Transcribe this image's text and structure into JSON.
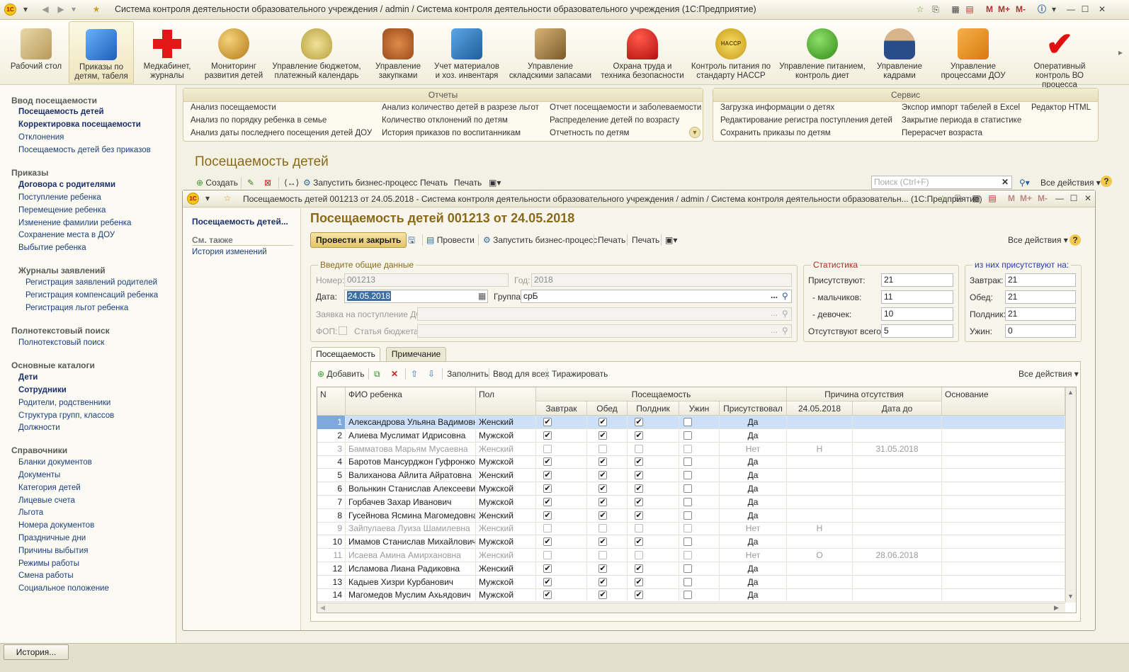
{
  "window": {
    "title": "Система контроля деятельности образовательного учреждения / admin / Система контроля деятельности образовательного учреждения  (1С:Предприятие)",
    "tb_right": [
      "M",
      "M+",
      "M-"
    ]
  },
  "sections": [
    {
      "label": "Рабочий стол"
    },
    {
      "label": "Приказы по детям, табеля"
    },
    {
      "label": "Медкабинет, журналы"
    },
    {
      "label": "Мониторинг развития детей"
    },
    {
      "label": "Управление бюджетом, платежный календарь"
    },
    {
      "label": "Управление закупками"
    },
    {
      "label": "Учет материалов и хоз. инвентаря"
    },
    {
      "label": "Управление складскими запасами"
    },
    {
      "label": "Охрана труда и техника безопасности"
    },
    {
      "label": "Контроль питания по стандарту HACCP"
    },
    {
      "label": "Управление питанием, контроль диет"
    },
    {
      "label": "Управление кадрами"
    },
    {
      "label": "Управление процессами ДОУ"
    },
    {
      "label": "Оперативный контроль ВО процесса"
    }
  ],
  "haccp_badge": "HACCP",
  "leftnav": {
    "g1": "Ввод посещаемости",
    "g1_items": [
      "Посещаемость детей",
      "Корректировка посещаемости",
      "Отклонения",
      "Посещаемость детей без приказов"
    ],
    "g2": "Приказы",
    "g2_items": [
      "Договора с родителями",
      "Поступление ребенка",
      "Перемещение ребенка",
      "Изменение фамилии ребенка",
      "Сохранение места в ДОУ",
      "Выбытие ребенка"
    ],
    "g3": "Журналы заявлений",
    "g3_items": [
      "Регистрация заявлений родителей",
      "Регистрация компенсаций ребенка",
      "Регистрация льгот ребенка"
    ],
    "g4": "Полнотекстовый поиск",
    "g4_items": [
      "Полнотекстовый поиск"
    ],
    "g5": "Основные каталоги",
    "g5_items": [
      "Дети",
      "Сотрудники",
      "Родители, родственники",
      "Структура групп, классов",
      "Должности"
    ],
    "g6": "Справочники",
    "g6_items": [
      "Бланки документов",
      "Документы",
      "Категория детей",
      "Лицевые счета",
      "Льгота",
      "Номера документов",
      "Праздничные дни",
      "Причины выбытия",
      "Режимы работы",
      "Смена работы",
      "Социальное положение"
    ]
  },
  "reports": {
    "title": "Отчеты",
    "col1": [
      "Анализ посещаемости",
      "Анализ по порядку ребенка в семье",
      "Анализ даты последнего посещения детей ДОУ"
    ],
    "col2": [
      "Анализ количество детей в разрезе льгот",
      "Количество отклонений по детям",
      "История приказов по воспитанникам"
    ],
    "col3": [
      "Отчет посещаемости и заболеваемости",
      "Распределение детей по возрасту",
      "Отчетность по детям"
    ]
  },
  "service": {
    "title": "Сервис",
    "col1": [
      "Загрузка информации о детях",
      "Редактирование регистра поступления детей",
      "Сохранить приказы по детям"
    ],
    "col2": [
      "Экспор импорт табелей в Excel",
      "Закрытие периода в статистике",
      "Перерасчет возраста"
    ],
    "col3": [
      "Редактор HTML"
    ]
  },
  "list_page": {
    "title": "Посещаемость детей",
    "create": "Создать",
    "run_bp": "Запустить бизнес-процесс",
    "print1": "Печать",
    "print2": "Печать",
    "search_placeholder": "Поиск (Ctrl+F)",
    "all_actions": "Все действия"
  },
  "doc": {
    "window_title": "Посещаемость детей 001213 от 24.05.2018 - Система контроля деятельности образовательного учреждения / admin / Система контроля деятельности образовательн... (1С:Предприятие)",
    "nav_current": "Посещаемость детей...",
    "see_also": "См. также",
    "history": "История изменений",
    "heading": "Посещаемость детей 001213 от 24.05.2018",
    "post_close": "Провести и закрыть",
    "post": "Провести",
    "run_bp": "Запустить бизнес-процесс",
    "print1": "Печать",
    "print2": "Печать",
    "all_actions": "Все действия",
    "general_group": "Введите общие данные",
    "number_label": "Номер:",
    "number": "001213",
    "year_label": "Год:",
    "year": "2018",
    "date_label": "Дата:",
    "date": "24.05.2018",
    "group_label": "Группа:",
    "group": "срБ",
    "request_label": "Заявка на поступление ДС:",
    "fop_label": "ФОП:",
    "budget_label": "Статья бюджета:",
    "stats_group": "Статистика",
    "present_label": "Присутствуют:",
    "present": "21",
    "boys_label": "- мальчиков:",
    "boys": "11",
    "girls_label": "- девочек:",
    "girls": "10",
    "absent_label": "Отсутствуют всего:",
    "absent": "5",
    "meals_group": "из них присутствуют на:",
    "breakfast_label": "Завтрак:",
    "breakfast": "21",
    "lunch_label": "Обед:",
    "lunch": "21",
    "snack_label": "Полдник:",
    "snack": "21",
    "dinner_label": "Ужин:",
    "dinner": "0",
    "tab1": "Посещаемость",
    "tab2": "Примечание",
    "add": "Добавить",
    "fill": "Заполнить",
    "input_all": "Ввод для всех",
    "replicate": "Тиражировать",
    "grid_all_actions": "Все действия"
  },
  "grid": {
    "h_n": "N",
    "h_fio": "ФИО ребенка",
    "h_sex": "Пол",
    "h_att": "Посещаемость",
    "h_breakfast": "Завтрак",
    "h_lunch": "Обед",
    "h_snack": "Полдник",
    "h_dinner": "Ужин",
    "h_present": "Присутствовал",
    "h_reason": "Причина отсутствия",
    "h_date": "24.05.2018",
    "h_date_to": "Дата до",
    "h_basis": "Основание",
    "rows": [
      {
        "n": "1",
        "fio": "Александрова Ульяна Вадимовна",
        "sex": "Женский",
        "b": true,
        "l": true,
        "s": true,
        "d": false,
        "p": "Да",
        "r": "",
        "to": ""
      },
      {
        "n": "2",
        "fio": "Алиева Муслимат Идрисовна",
        "sex": "Мужской",
        "b": true,
        "l": true,
        "s": true,
        "d": false,
        "p": "Да",
        "r": "",
        "to": ""
      },
      {
        "n": "3",
        "fio": "Бамматова Марьям Мусаевна",
        "sex": "Женский",
        "b": false,
        "l": false,
        "s": false,
        "d": false,
        "p": "Нет",
        "r": "Н",
        "to": "31.05.2018"
      },
      {
        "n": "4",
        "fio": "Баротов Мансурджон Гуфронжон...",
        "sex": "Мужской",
        "b": true,
        "l": true,
        "s": true,
        "d": false,
        "p": "Да",
        "r": "",
        "to": ""
      },
      {
        "n": "5",
        "fio": "Валиханова Айлита Айратовна",
        "sex": "Женский",
        "b": true,
        "l": true,
        "s": true,
        "d": false,
        "p": "Да",
        "r": "",
        "to": ""
      },
      {
        "n": "6",
        "fio": "Вольнкин Станислав Алексеевич",
        "sex": "Мужской",
        "b": true,
        "l": true,
        "s": true,
        "d": false,
        "p": "Да",
        "r": "",
        "to": ""
      },
      {
        "n": "7",
        "fio": "Горбачев Захар Иванович",
        "sex": "Мужской",
        "b": true,
        "l": true,
        "s": true,
        "d": false,
        "p": "Да",
        "r": "",
        "to": ""
      },
      {
        "n": "8",
        "fio": "Гусейнова Ясмина Магомедовна",
        "sex": "Женский",
        "b": true,
        "l": true,
        "s": true,
        "d": false,
        "p": "Да",
        "r": "",
        "to": ""
      },
      {
        "n": "9",
        "fio": "Зайпулаева Луиза Шамилевна",
        "sex": "Женский",
        "b": false,
        "l": false,
        "s": false,
        "d": false,
        "p": "Нет",
        "r": "Н",
        "to": ""
      },
      {
        "n": "10",
        "fio": "Имамов Станислав Михайлович",
        "sex": "Мужской",
        "b": true,
        "l": true,
        "s": true,
        "d": false,
        "p": "Да",
        "r": "",
        "to": ""
      },
      {
        "n": "11",
        "fio": "Исаева Амина Амирхановна",
        "sex": "Женский",
        "b": false,
        "l": false,
        "s": false,
        "d": false,
        "p": "Нет",
        "r": "О",
        "to": "28.06.2018"
      },
      {
        "n": "12",
        "fio": "Исламова Лиана Радиковна",
        "sex": "Женский",
        "b": true,
        "l": true,
        "s": true,
        "d": false,
        "p": "Да",
        "r": "",
        "to": ""
      },
      {
        "n": "13",
        "fio": "Кадыев Хизри Курбанович",
        "sex": "Мужской",
        "b": true,
        "l": true,
        "s": true,
        "d": false,
        "p": "Да",
        "r": "",
        "to": ""
      },
      {
        "n": "14",
        "fio": "Магомедов Муслим Ахьядович",
        "sex": "Мужской",
        "b": true,
        "l": true,
        "s": true,
        "d": false,
        "p": "Да",
        "r": "",
        "to": ""
      }
    ]
  },
  "bottom": {
    "history_btn": "История..."
  },
  "colors": {
    "accent": "#c7a84a",
    "brand_heading": "#8a6a1a",
    "selection": "#cce0f7"
  }
}
